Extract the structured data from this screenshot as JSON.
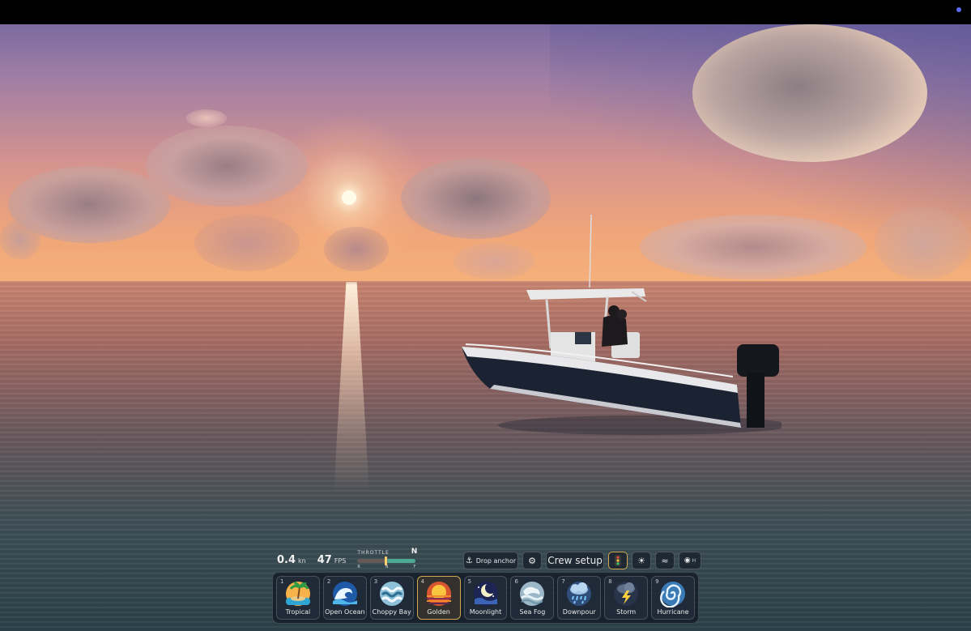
{
  "hud": {
    "speed": {
      "value": "0.4",
      "unit": "kn"
    },
    "fps": {
      "value": "47",
      "unit": "FPS"
    },
    "throttle": {
      "label": "THROTTLE",
      "gear": "N",
      "ticks": [
        "R",
        "N",
        "F"
      ]
    }
  },
  "actions": {
    "anchor_label": "Drop anchor",
    "settings_icon": "gear-icon",
    "crew_label": "Crew setup",
    "toggles": [
      "traffic-light-icon",
      "sun-icon",
      "waves-icon"
    ],
    "hotkey_label": "H"
  },
  "presets": [
    {
      "key": "1",
      "label": "Tropical",
      "icon": "palm-island-icon",
      "active": false
    },
    {
      "key": "2",
      "label": "Open Ocean",
      "icon": "wave-icon",
      "active": false
    },
    {
      "key": "3",
      "label": "Choppy Bay",
      "icon": "choppy-waves-icon",
      "active": false
    },
    {
      "key": "4",
      "label": "Golden",
      "icon": "sunset-icon",
      "active": true
    },
    {
      "key": "5",
      "label": "Moonlight",
      "icon": "moon-icon",
      "active": false
    },
    {
      "key": "6",
      "label": "Sea Fog",
      "icon": "fog-icon",
      "active": false
    },
    {
      "key": "7",
      "label": "Downpour",
      "icon": "rain-cloud-icon",
      "active": false
    },
    {
      "key": "8",
      "label": "Storm",
      "icon": "lightning-icon",
      "active": false
    },
    {
      "key": "9",
      "label": "Hurricane",
      "icon": "hurricane-icon",
      "active": false
    }
  ],
  "colors": {
    "accent": "#d5a74f",
    "panel": "#101824"
  }
}
